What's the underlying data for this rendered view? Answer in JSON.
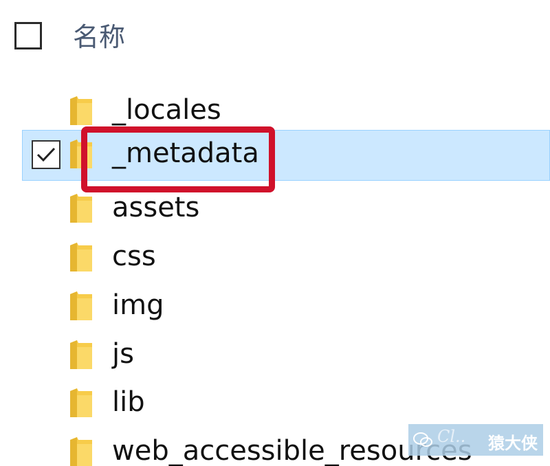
{
  "header": {
    "name_column_label": "名称"
  },
  "files": [
    {
      "name": "_locales",
      "icon": "folder-icon",
      "selected": false
    },
    {
      "name": "_metadata",
      "icon": "folder-icon",
      "selected": true
    },
    {
      "name": "assets",
      "icon": "folder-icon",
      "selected": false
    },
    {
      "name": "css",
      "icon": "folder-icon",
      "selected": false
    },
    {
      "name": "img",
      "icon": "folder-icon",
      "selected": false
    },
    {
      "name": "js",
      "icon": "folder-icon",
      "selected": false
    },
    {
      "name": "lib",
      "icon": "folder-icon",
      "selected": false
    },
    {
      "name": "web_accessible_resources",
      "icon": "folder-icon",
      "selected": false
    }
  ],
  "colors": {
    "selection_background": "#cce8ff",
    "highlight_border": "#d0112b",
    "folder_yellow": "#f7cc4a"
  },
  "watermark": {
    "text": "猿大侠"
  }
}
